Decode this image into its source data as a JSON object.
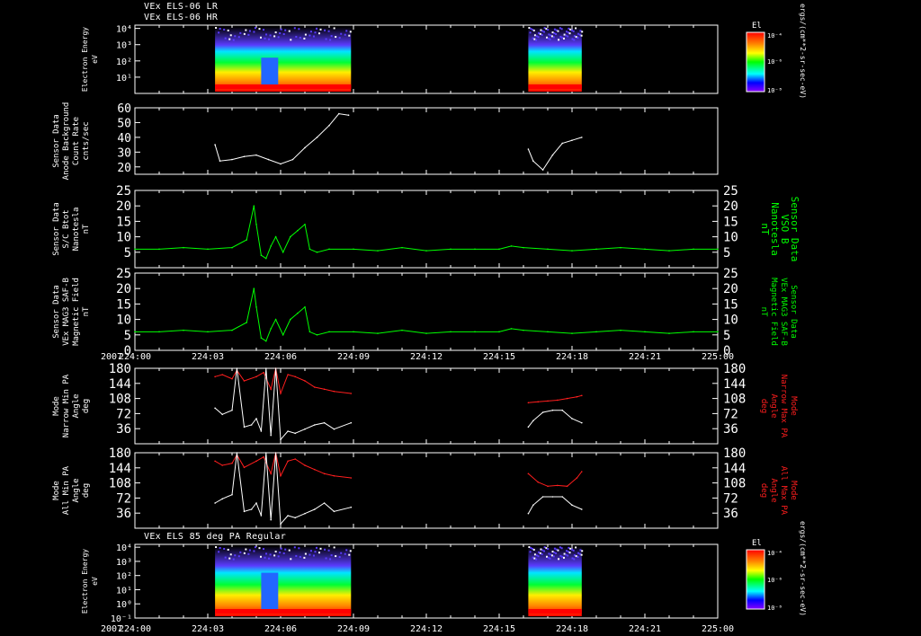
{
  "header": {
    "line1": "VEx ELS-06 LR",
    "line2": "VEx ELS-06 HR",
    "bottom_title": "VEx ELS 85 deg PA Regular"
  },
  "time_axis": {
    "year": "2007",
    "ticks": [
      "224:00",
      "224:03",
      "224:06",
      "224:09",
      "224:12",
      "224:15",
      "224:18",
      "224:21",
      "225:00"
    ]
  },
  "colorbar": {
    "title": "El",
    "tick_labels": [
      "10⁻⁴",
      "10⁻⁶",
      "10⁻⁸"
    ],
    "unit_label": "ergs/(cm**2-sr-sec-eV)"
  },
  "colors": {
    "green": "#00ff00",
    "red": "#ff1e1e",
    "white": "#ffffff",
    "black": "#000000"
  },
  "chart_data": [
    {
      "id": "energy-top",
      "type": "heatmap",
      "ylabel": [
        "Electron Energy",
        "eV"
      ],
      "y_tick_labels": [
        "10⁴",
        "10³",
        "10²",
        "10¹"
      ],
      "x_range": [
        0,
        24
      ],
      "y_range": [
        0,
        4.2
      ],
      "data_intervals": [
        [
          3.3,
          8.9
        ],
        [
          16.2,
          18.4
        ]
      ],
      "gap_interval": [
        5.2,
        5.9
      ]
    },
    {
      "id": "background",
      "type": "line",
      "ylabel": [
        "Sensor Data",
        "Anode Background",
        "Count Rate",
        "cnts/sec"
      ],
      "ylim": [
        15,
        60
      ],
      "y_ticks": [
        20,
        30,
        40,
        50,
        60
      ],
      "series": [
        {
          "color": "white",
          "segments": [
            {
              "x": [
                3.3,
                3.5,
                4.0,
                4.5,
                5.0,
                5.5,
                6.0,
                6.5,
                7.0,
                7.5,
                8.0,
                8.4,
                8.8
              ],
              "y": [
                35,
                24,
                25,
                27,
                28,
                25,
                22,
                25,
                33,
                40,
                48,
                56,
                55
              ]
            },
            {
              "x": [
                16.2,
                16.4,
                16.8,
                17.2,
                17.6,
                18.0,
                18.4
              ],
              "y": [
                32,
                24,
                18,
                28,
                36,
                38,
                40
              ]
            }
          ]
        }
      ]
    },
    {
      "id": "btot",
      "type": "line",
      "ylabel": [
        "Sensor Data",
        "S/C Btot",
        "Nanotesla",
        "nT"
      ],
      "y2label": [
        "Sensor Data",
        "VSO B",
        "Nanotesla",
        "nT"
      ],
      "ylim": [
        0,
        25
      ],
      "y_ticks": [
        5,
        10,
        15,
        20,
        25
      ],
      "series": [
        {
          "color": "green",
          "segments": [
            {
              "x": [
                0,
                1,
                2,
                3,
                4,
                4.6,
                4.9,
                5.0,
                5.2,
                5.4,
                5.6,
                5.8,
                6.1,
                6.4,
                6.7,
                7.0,
                7.2,
                7.5,
                8,
                9,
                10,
                11,
                12,
                13,
                14,
                15,
                15.5,
                16,
                17,
                18,
                19,
                20,
                21,
                22,
                23,
                24
              ],
              "y": [
                6,
                6,
                6.5,
                6,
                6.5,
                9,
                20,
                14,
                4,
                3,
                7,
                10,
                5,
                10,
                12,
                14,
                6,
                5,
                6,
                6,
                5.5,
                6.5,
                5.5,
                6,
                6,
                6,
                7,
                6.5,
                6,
                5.5,
                6,
                6.5,
                6,
                5.5,
                6,
                6
              ]
            }
          ]
        }
      ]
    },
    {
      "id": "mag03",
      "type": "line",
      "ylabel": [
        "Sensor Data",
        "VEx MAG3 SAF-B",
        "Magnetic Field",
        "nT"
      ],
      "y2label": [
        "Sensor Data",
        "VEx MAG3 SAF-B",
        "Magnetic Field",
        "nT"
      ],
      "ylim": [
        0,
        25
      ],
      "y_ticks": [
        0,
        5,
        10,
        15,
        20,
        25
      ],
      "series": [
        {
          "color": "green",
          "segments": [
            {
              "x": [
                0,
                1,
                2,
                3,
                4,
                4.6,
                4.9,
                5.0,
                5.2,
                5.4,
                5.6,
                5.8,
                6.1,
                6.4,
                6.7,
                7.0,
                7.2,
                7.5,
                8,
                9,
                10,
                11,
                12,
                13,
                14,
                15,
                15.5,
                16,
                17,
                18,
                19,
                20,
                21,
                22,
                23,
                24
              ],
              "y": [
                6,
                6,
                6.5,
                6,
                6.5,
                9,
                20,
                14,
                4,
                3,
                7,
                10,
                5,
                10,
                12,
                14,
                6,
                5,
                6,
                6,
                5.5,
                6.5,
                5.5,
                6,
                6,
                6,
                7,
                6.5,
                6,
                5.5,
                6,
                6.5,
                6,
                5.5,
                6,
                6
              ]
            }
          ]
        }
      ]
    },
    {
      "id": "narrow-pa",
      "type": "line",
      "ylabel": [
        "Mode",
        "Narrow Min PA",
        "Angle",
        "deg"
      ],
      "y2label": [
        "Mode",
        "Narrow Max PA",
        "Angle",
        "deg"
      ],
      "ylim": [
        0,
        180
      ],
      "y_ticks": [
        36,
        72,
        108,
        144,
        180
      ],
      "series": [
        {
          "color": "red",
          "segments": [
            {
              "x": [
                3.3,
                3.6,
                4.0,
                4.2,
                4.5,
                5.0,
                5.3,
                5.6,
                5.8,
                6.0,
                6.3,
                6.6,
                7.0,
                7.4,
                7.8,
                8.2,
                8.9
              ],
              "y": [
                160,
                165,
                155,
                175,
                150,
                160,
                170,
                130,
                180,
                120,
                165,
                160,
                150,
                135,
                130,
                125,
                120
              ]
            },
            {
              "x": [
                16.2,
                16.6,
                17.0,
                17.4,
                17.8,
                18.2,
                18.4
              ],
              "y": [
                98,
                100,
                102,
                104,
                108,
                112,
                115
              ]
            }
          ]
        },
        {
          "color": "white",
          "segments": [
            {
              "x": [
                3.3,
                3.6,
                4.0,
                4.2,
                4.5,
                4.8,
                5.0,
                5.2,
                5.4,
                5.6,
                5.8,
                6.0,
                6.3,
                6.6,
                7.0,
                7.4,
                7.8,
                8.2,
                8.9
              ],
              "y": [
                85,
                70,
                80,
                180,
                40,
                45,
                60,
                30,
                180,
                20,
                180,
                10,
                30,
                25,
                35,
                45,
                50,
                35,
                50
              ]
            },
            {
              "x": [
                16.2,
                16.4,
                16.8,
                17.2,
                17.6,
                18.0,
                18.4
              ],
              "y": [
                40,
                55,
                75,
                80,
                80,
                60,
                50
              ]
            }
          ]
        }
      ]
    },
    {
      "id": "all-pa",
      "type": "line",
      "ylabel": [
        "Mode",
        "All Min PA",
        "Angle",
        "deg"
      ],
      "y2label": [
        "Mode",
        "All Max PA",
        "Angle",
        "deg"
      ],
      "ylim": [
        0,
        180
      ],
      "y_ticks": [
        36,
        72,
        108,
        144,
        180
      ],
      "series": [
        {
          "color": "red",
          "segments": [
            {
              "x": [
                3.3,
                3.6,
                4.0,
                4.2,
                4.5,
                5.0,
                5.3,
                5.6,
                5.8,
                6.0,
                6.3,
                6.6,
                7.0,
                7.4,
                7.8,
                8.2,
                8.9
              ],
              "y": [
                160,
                150,
                155,
                175,
                145,
                160,
                170,
                130,
                180,
                125,
                160,
                165,
                150,
                140,
                130,
                125,
                120
              ]
            },
            {
              "x": [
                16.2,
                16.6,
                17.0,
                17.4,
                17.8,
                18.2,
                18.4
              ],
              "y": [
                130,
                110,
                100,
                102,
                100,
                120,
                135
              ]
            }
          ]
        },
        {
          "color": "white",
          "segments": [
            {
              "x": [
                3.3,
                3.6,
                4.0,
                4.2,
                4.5,
                4.8,
                5.0,
                5.2,
                5.4,
                5.6,
                5.8,
                6.0,
                6.3,
                6.6,
                7.0,
                7.4,
                7.8,
                8.2,
                8.9
              ],
              "y": [
                60,
                70,
                80,
                180,
                40,
                45,
                60,
                30,
                180,
                20,
                180,
                10,
                30,
                25,
                35,
                45,
                60,
                40,
                50
              ]
            },
            {
              "x": [
                16.2,
                16.4,
                16.8,
                17.2,
                17.6,
                18.0,
                18.4
              ],
              "y": [
                35,
                55,
                75,
                75,
                75,
                55,
                45
              ]
            }
          ]
        }
      ]
    },
    {
      "id": "energy-bottom",
      "type": "heatmap",
      "ylabel": [
        "Electron Energy",
        "eV"
      ],
      "y_tick_labels": [
        "10⁴",
        "10³",
        "10²",
        "10¹",
        "10⁰",
        "10⁻¹"
      ],
      "x_range": [
        0,
        24
      ],
      "y_range": [
        -1,
        4.2
      ],
      "data_intervals": [
        [
          3.3,
          8.9
        ],
        [
          16.2,
          18.4
        ]
      ],
      "gap_interval": [
        5.2,
        5.9
      ]
    }
  ]
}
